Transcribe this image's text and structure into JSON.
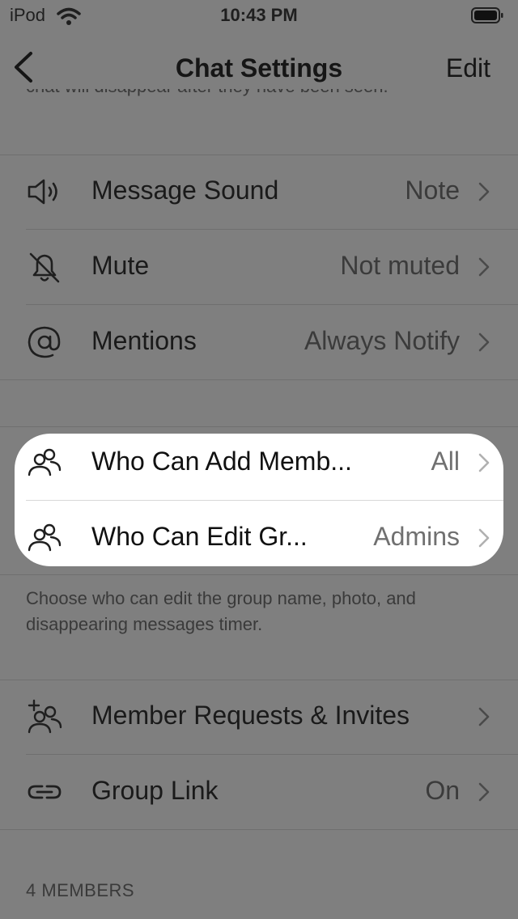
{
  "status_bar": {
    "carrier": "iPod",
    "time": "10:43 PM"
  },
  "nav": {
    "title": "Chat Settings",
    "edit_label": "Edit"
  },
  "clipped_text": "chat will disappear after they have been seen.",
  "notification_rows": [
    {
      "label": "Message Sound",
      "value": "Note",
      "icon": "speaker-icon"
    },
    {
      "label": "Mute",
      "value": "Not muted",
      "icon": "bell-slash-icon"
    },
    {
      "label": "Mentions",
      "value": "Always Notify",
      "icon": "at-sign-icon"
    }
  ],
  "permission_rows": [
    {
      "label": "Who Can Add Memb...",
      "value": "All",
      "icon": "group-icon"
    },
    {
      "label": "Who Can Edit Gr...",
      "value": "Admins",
      "icon": "group-icon"
    }
  ],
  "permission_footer": "Choose who can edit the group name, photo, and disappearing messages timer.",
  "group_rows": [
    {
      "label": "Member Requests & Invites",
      "value": "",
      "icon": "group-add-icon"
    },
    {
      "label": "Group Link",
      "value": "On",
      "icon": "link-icon"
    }
  ],
  "members_header": "4 MEMBERS",
  "colors": {
    "dim_background": "#7f7f7f",
    "highlight": "#ffffff"
  }
}
